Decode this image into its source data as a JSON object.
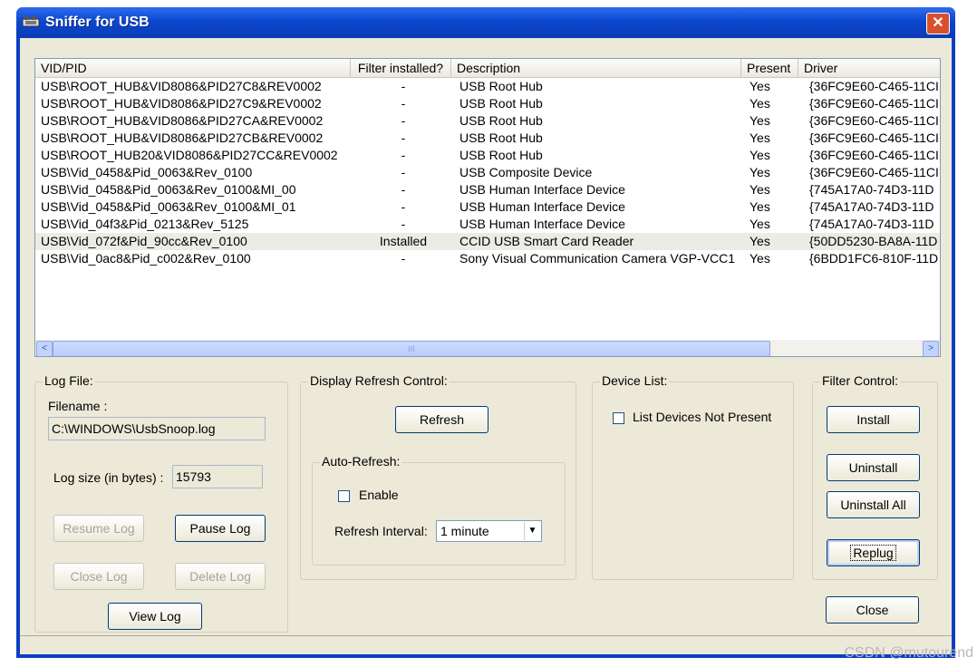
{
  "window": {
    "title": "Sniffer for USB",
    "close_glyph": "✕",
    "icon": "usb-app-icon"
  },
  "device_list": {
    "columns": [
      "VID/PID",
      "Filter installed?",
      "Description",
      "Present",
      "Driver"
    ],
    "rows": [
      [
        "USB\\ROOT_HUB&VID8086&PID27C8&REV0002",
        "-",
        "USB Root Hub",
        "Yes",
        "{36FC9E60-C465-11CI"
      ],
      [
        "USB\\ROOT_HUB&VID8086&PID27C9&REV0002",
        "-",
        "USB Root Hub",
        "Yes",
        "{36FC9E60-C465-11CI"
      ],
      [
        "USB\\ROOT_HUB&VID8086&PID27CA&REV0002",
        "-",
        "USB Root Hub",
        "Yes",
        "{36FC9E60-C465-11CI"
      ],
      [
        "USB\\ROOT_HUB&VID8086&PID27CB&REV0002",
        "-",
        "USB Root Hub",
        "Yes",
        "{36FC9E60-C465-11CI"
      ],
      [
        "USB\\ROOT_HUB20&VID8086&PID27CC&REV0002",
        "-",
        "USB Root Hub",
        "Yes",
        "{36FC9E60-C465-11CI"
      ],
      [
        "USB\\Vid_0458&Pid_0063&Rev_0100",
        "-",
        "USB Composite Device",
        "Yes",
        "{36FC9E60-C465-11CI"
      ],
      [
        "USB\\Vid_0458&Pid_0063&Rev_0100&MI_00",
        "-",
        "USB Human Interface Device",
        "Yes",
        "{745A17A0-74D3-11D"
      ],
      [
        "USB\\Vid_0458&Pid_0063&Rev_0100&MI_01",
        "-",
        "USB Human Interface Device",
        "Yes",
        "{745A17A0-74D3-11D"
      ],
      [
        "USB\\Vid_04f3&Pid_0213&Rev_5125",
        "-",
        "USB Human Interface Device",
        "Yes",
        "{745A17A0-74D3-11D"
      ],
      [
        "USB\\Vid_072f&Pid_90cc&Rev_0100",
        "Installed",
        "CCID USB Smart Card Reader",
        "Yes",
        "{50DD5230-BA8A-11D"
      ],
      [
        "USB\\Vid_0ac8&Pid_c002&Rev_0100",
        "-",
        "Sony Visual Communication Camera VGP-VCC1",
        "Yes",
        "{6BDD1FC6-810F-11D"
      ]
    ],
    "selected_row": 9,
    "scroll_left": "<",
    "scroll_right": ">",
    "scroll_grip": "III"
  },
  "log_file": {
    "label": "Log File:",
    "filename_label": "Filename :",
    "filename_value": "C:\\WINDOWS\\UsbSnoop.log",
    "size_label": "Log size (in bytes) :",
    "size_value": "15793",
    "resume": "Resume Log",
    "pause": "Pause Log",
    "close": "Close Log",
    "delete": "Delete Log",
    "view": "View Log"
  },
  "refresh": {
    "label": "Display Refresh Control:",
    "refresh_button": "Refresh",
    "auto_label": "Auto-Refresh:",
    "enable_label": "Enable",
    "interval_label": "Refresh Interval:",
    "interval_value": "1 minute",
    "dropdown_arrow": "▼"
  },
  "device_filter": {
    "label": "Device List:",
    "not_present_label": "List Devices Not Present"
  },
  "filter_control": {
    "label": "Filter Control:",
    "install": "Install",
    "uninstall": "Uninstall",
    "uninstall_all": "Uninstall All",
    "replug": "Replug"
  },
  "footer": {
    "close": "Close",
    "watermark": "CSDN @mutourend"
  }
}
